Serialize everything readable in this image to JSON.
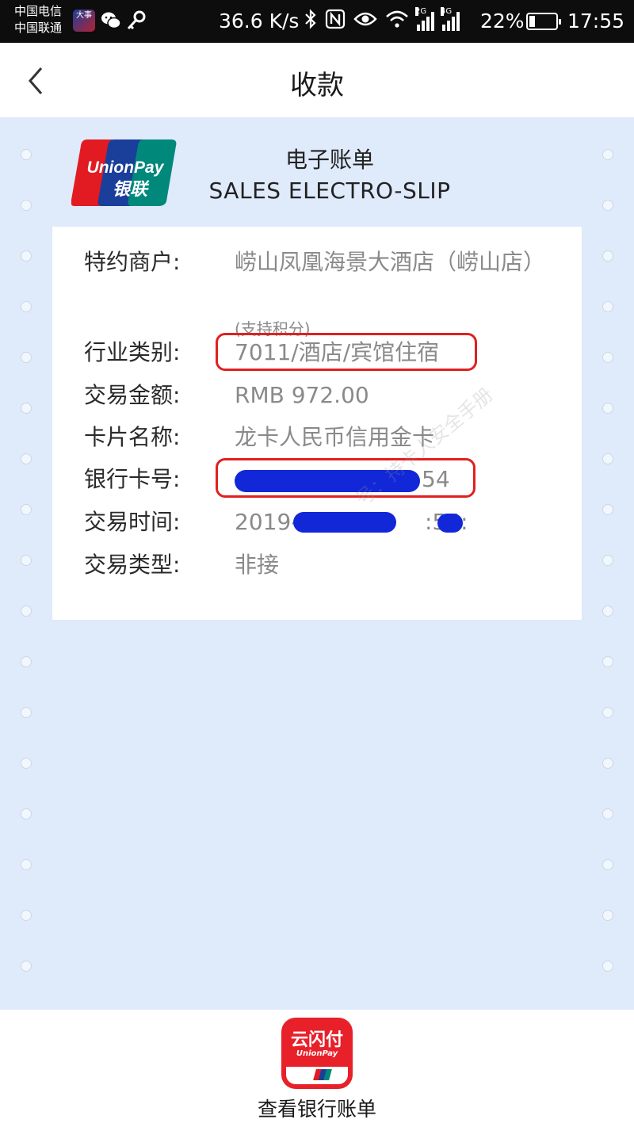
{
  "status_bar": {
    "carrier_1": "中国电信",
    "carrier_2": "中国联通",
    "news_app_text": "大事",
    "net_speed": "36.6 K/s",
    "signal_1_tag": "2G",
    "signal_2_tag": "4G",
    "battery_percent": "22%",
    "battery_level": 0.22,
    "time": "17:55",
    "icons": [
      "news-app-icon",
      "wechat-icon",
      "key-icon",
      "bluetooth-icon",
      "nfc-icon",
      "eye-icon",
      "wifi-icon",
      "signal-2g-icon",
      "signal-4g-icon",
      "battery-icon"
    ]
  },
  "nav": {
    "back_icon": "chevron-left-icon",
    "title": "收款"
  },
  "slip": {
    "logo": {
      "text_1": "UnionPay",
      "text_2": "银联"
    },
    "title_cn": "电子账单",
    "title_en": "SALES  ELECTRO-SLIP",
    "watermark": "号：持卡人安全手册",
    "fields": [
      {
        "label": "特约商户:",
        "value": "崂山凤凰海景大酒店（崂山店）",
        "note": "(支持积分)"
      },
      {
        "label": "行业类别:",
        "value": "7011/酒店/宾馆住宿"
      },
      {
        "label": "交易金额:",
        "value": "RMB  972.00"
      },
      {
        "label": "卡片名称:",
        "value": "龙卡人民币信用金卡"
      },
      {
        "label": "银行卡号:",
        "value": "54"
      },
      {
        "label": "交易时间:",
        "value_prefix": "2019-",
        "value_mid": ":55:"
      },
      {
        "label": "交易类型:",
        "value": "非接"
      }
    ],
    "highlight_color": "#e02020",
    "redaction_color": "#1227d8"
  },
  "bottom": {
    "app_icon": {
      "text_1": "云闪付",
      "text_2": "UnionPay"
    },
    "link_label": "查看银行账单"
  },
  "colors": {
    "status_bar_bg": "#0d0d0d",
    "slip_bg": "#dfeafb",
    "unionpay_red": "#e21b22",
    "unionpay_blue": "#1a3f9a",
    "unionpay_teal": "#00897b"
  }
}
